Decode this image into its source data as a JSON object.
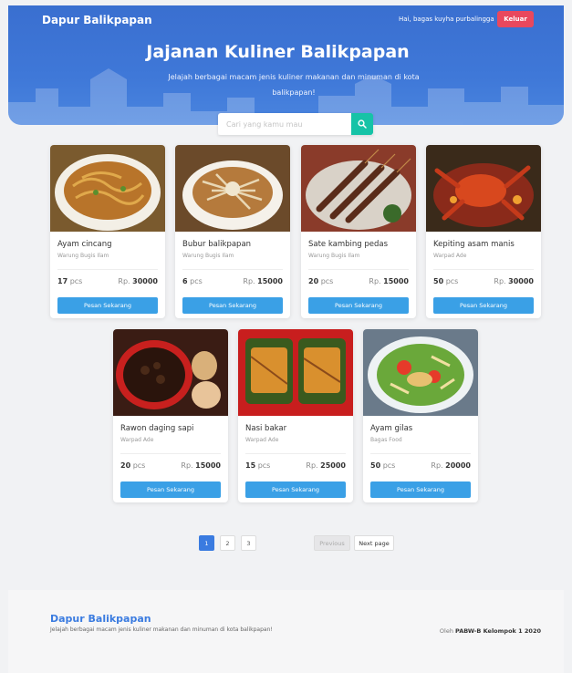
{
  "header": {
    "brand": "Dapur Balikpapan",
    "greeting": "Hai, bagas kuyha purbalingga",
    "logout_label": "Keluar"
  },
  "hero": {
    "title": "Jajanan Kuliner Balikpapan",
    "subtitle": "Jelajah berbagai macam jenis kuliner makanan dan minuman di kota balikpapan!"
  },
  "search": {
    "placeholder": "Cari yang kamu mau",
    "icon": "search-icon"
  },
  "currency_prefix": "Rp.",
  "qty_unit": "pcs",
  "order_label": "Pesan Sekarang",
  "products": [
    {
      "name": "Ayam cincang",
      "seller": "Warung Bugis Ilam",
      "qty": "17",
      "price": "30000",
      "image": "noodle-dish"
    },
    {
      "name": "Bubur balikpapan",
      "seller": "Warung Bugis Ilam",
      "qty": "6",
      "price": "15000",
      "image": "porridge-bowl"
    },
    {
      "name": "Sate kambing pedas",
      "seller": "Warung Bugis Ilam",
      "qty": "20",
      "price": "15000",
      "image": "satay-skewers"
    },
    {
      "name": "Kepiting asam manis",
      "seller": "Warpad Ade",
      "qty": "50",
      "price": "30000",
      "image": "crab-dish"
    },
    {
      "name": "Rawon daging sapi",
      "seller": "Warpad Ade",
      "qty": "20",
      "price": "15000",
      "image": "beef-soup"
    },
    {
      "name": "Nasi bakar",
      "seller": "Warpad Ade",
      "qty": "15",
      "price": "25000",
      "image": "grilled-rice-leaf"
    },
    {
      "name": "Ayam gilas",
      "seller": "Bagas Food",
      "qty": "50",
      "price": "20000",
      "image": "chicken-salad"
    }
  ],
  "pagination": {
    "pages": [
      "1",
      "2",
      "3"
    ],
    "active": "1",
    "prev_label": "Previous",
    "next_label": "Next page"
  },
  "footer": {
    "brand": "Dapur Balikpapan",
    "tagline": "Jelajah berbagai macam jenis kuliner makanan dan minuman di kota balikpapan!",
    "credit_prefix": "Oleh",
    "credit_name": "PABW-B Kelompok 1 2020"
  },
  "colors": {
    "hero": "#3f78d8",
    "logout": "#e9485d",
    "search_button": "#16c3a7",
    "order_button": "#3aa0e6",
    "page_active": "#3a7be0"
  }
}
